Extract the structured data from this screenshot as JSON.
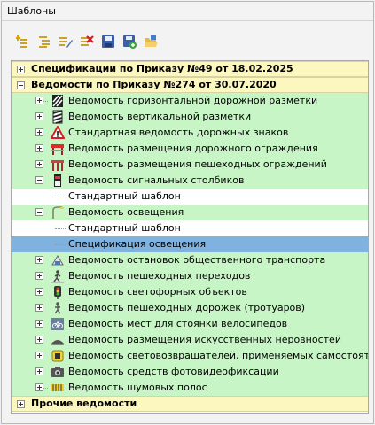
{
  "panel": {
    "title": "Шаблоны"
  },
  "toolbar": {
    "buttons": [
      {
        "name": "add-template-button",
        "icon": "add-template-icon"
      },
      {
        "name": "add-subtemplate-button",
        "icon": "add-subtemplate-icon"
      },
      {
        "name": "edit-template-button",
        "icon": "edit-template-icon"
      },
      {
        "name": "delete-template-button",
        "icon": "delete-template-icon"
      },
      {
        "name": "save-button",
        "icon": "save-icon"
      },
      {
        "name": "save-as-button",
        "icon": "save-as-icon"
      },
      {
        "name": "open-folder-button",
        "icon": "open-folder-icon"
      }
    ]
  },
  "tree": {
    "groups": {
      "spec49": "Спецификации по Приказу №49 от 18.02.2025",
      "ved274": "Ведомости по Приказу №274 от 30.07.2020",
      "other": "Прочие ведомости"
    },
    "items": [
      "Ведомость горизонтальной дорожной разметки",
      "Ведомость вертикальной разметки",
      "Стандартная ведомость дорожных знаков",
      "Ведомость размещения дорожного ограждения",
      "Ведомость размещения пешеходных ограждений",
      "Ведомость сигнальных столбиков",
      "Стандартный шаблон",
      "Ведомость освещения",
      "Стандартный шаблон",
      "Спецификация освещения",
      "Ведомость остановок общественного транспорта",
      "Ведомость пешеходных переходов",
      "Ведомость светофорных объектов",
      "Ведомость пешеходных дорожек (тротуаров)",
      "Ведомость мест для стоянки велосипедов",
      "Ведомость размещения искусственных неровностей",
      "Ведомость световозвращателей, применяемых самостоятельно",
      "Ведомость средств фотовидеофиксации",
      "Ведомость шумовых полос"
    ]
  },
  "colors": {
    "group_bg": "#fbf7bf",
    "item_bg": "#c8f5c6",
    "selected_bg": "#7fb2de"
  }
}
